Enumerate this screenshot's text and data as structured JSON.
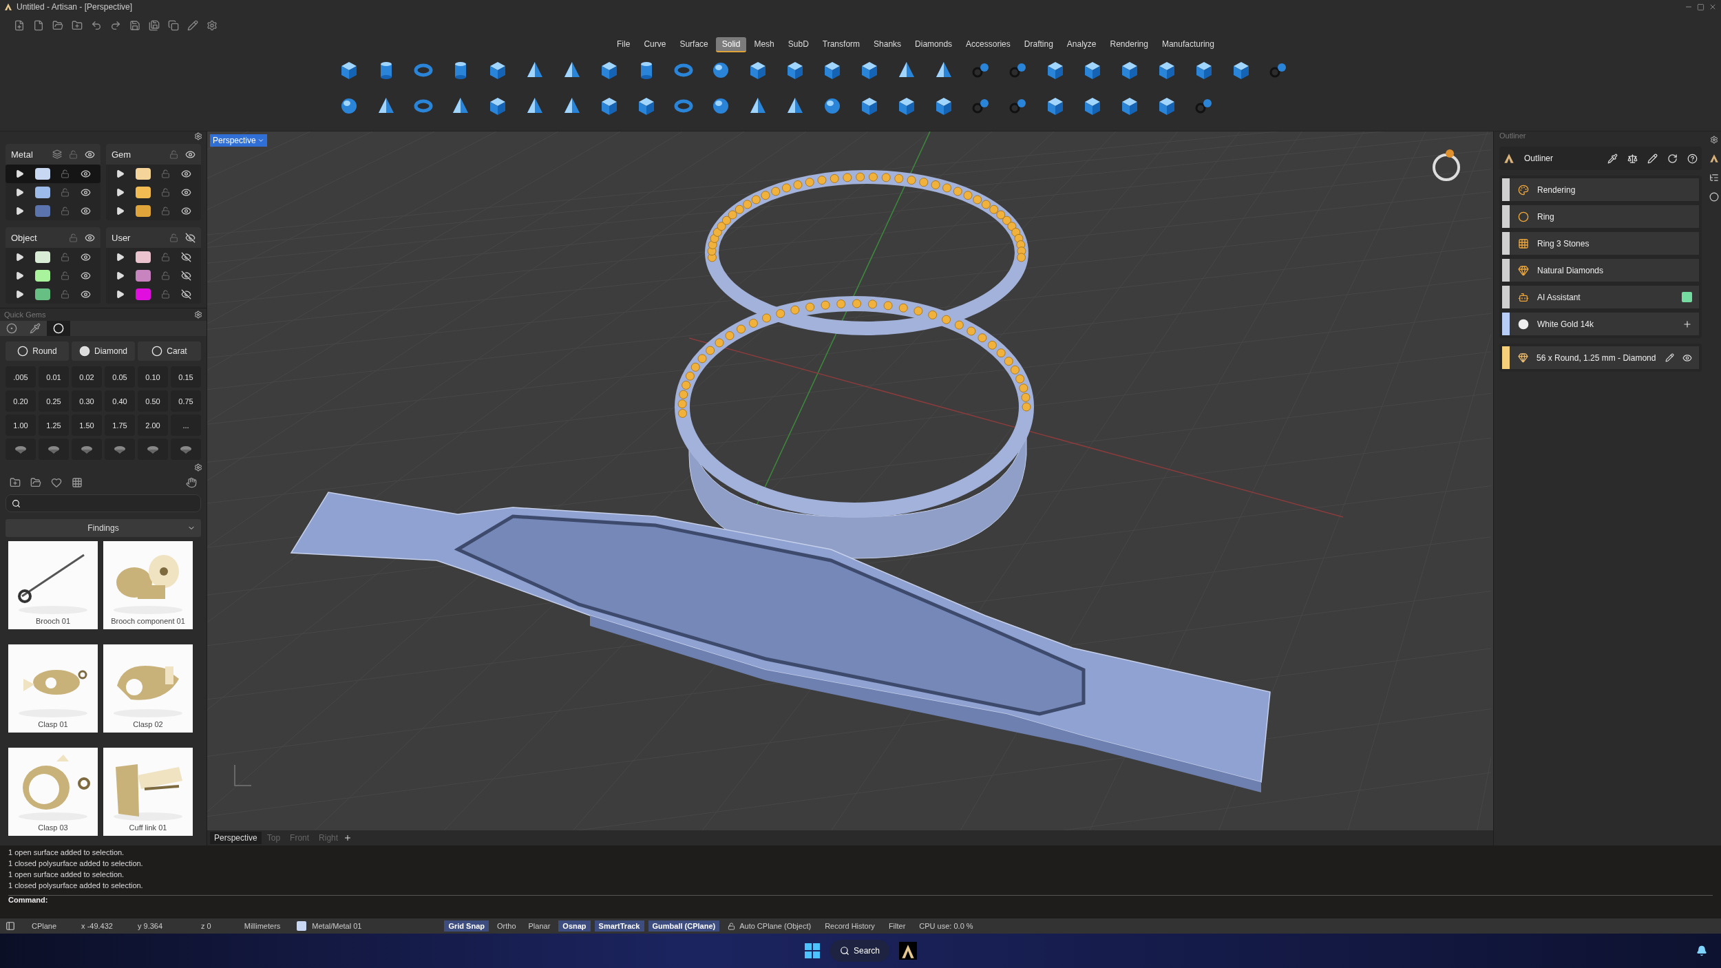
{
  "window": {
    "title": "Untitled - Artisan - [Perspective]"
  },
  "menu": [
    {
      "label": "File",
      "selected": false
    },
    {
      "label": "Curve",
      "selected": false
    },
    {
      "label": "Surface",
      "selected": false
    },
    {
      "label": "Solid",
      "selected": true
    },
    {
      "label": "Mesh",
      "selected": false
    },
    {
      "label": "SubD",
      "selected": false
    },
    {
      "label": "Transform",
      "selected": false
    },
    {
      "label": "Shanks",
      "selected": false
    },
    {
      "label": "Diamonds",
      "selected": false
    },
    {
      "label": "Accessories",
      "selected": false
    },
    {
      "label": "Drafting",
      "selected": false
    },
    {
      "label": "Analyze",
      "selected": false
    },
    {
      "label": "Rendering",
      "selected": false
    },
    {
      "label": "Manufacturing",
      "selected": false
    }
  ],
  "layer_groups": [
    {
      "name": "Metal",
      "kind": "material",
      "visible": true,
      "layers": [
        {
          "color": "#c8d8f2",
          "selected": true,
          "visible": true
        },
        {
          "color": "#9dbbe8",
          "selected": false,
          "visible": true
        },
        {
          "color": "#5b74ae",
          "selected": false,
          "visible": true
        }
      ]
    },
    {
      "name": "Gem",
      "kind": "plain",
      "visible": true,
      "layers": [
        {
          "color": "#f5d49a",
          "selected": false,
          "visible": true
        },
        {
          "color": "#f3bc52",
          "selected": false,
          "visible": true
        },
        {
          "color": "#e0a53a",
          "selected": false,
          "visible": true
        }
      ]
    },
    {
      "name": "Object",
      "kind": "plain",
      "visible": true,
      "layers": [
        {
          "color": "#d9ecd6",
          "selected": false,
          "visible": true
        },
        {
          "color": "#a8f39c",
          "selected": false,
          "visible": true
        },
        {
          "color": "#67bf83",
          "selected": false,
          "visible": true
        }
      ]
    },
    {
      "name": "User",
      "kind": "plain",
      "visible": false,
      "layers": [
        {
          "color": "#eac3cf",
          "selected": false,
          "visible": false
        },
        {
          "color": "#c884bf",
          "selected": false,
          "visible": false
        },
        {
          "color": "#e10ee0",
          "selected": false,
          "visible": false
        }
      ]
    }
  ],
  "quick_gems": {
    "title": "Quick Gems",
    "tabs": [
      {
        "selected": false
      },
      {
        "selected": false
      },
      {
        "selected": true
      }
    ],
    "options": [
      "Round",
      "Diamond",
      "Carat"
    ],
    "sizes": [
      ".005",
      "0.01",
      "0.02",
      "0.05",
      "0.10",
      "0.15",
      "0.20",
      "0.25",
      "0.30",
      "0.40",
      "0.50",
      "0.75",
      "1.00",
      "1.25",
      "1.50",
      "1.75",
      "2.00",
      "..."
    ]
  },
  "library": {
    "category": "Findings",
    "items": [
      {
        "label": "Brooch 01"
      },
      {
        "label": "Brooch component 01"
      },
      {
        "label": "Clasp 01"
      },
      {
        "label": "Clasp 02"
      },
      {
        "label": "Clasp 03"
      },
      {
        "label": "Cuff link 01"
      }
    ]
  },
  "viewport": {
    "label": "Perspective",
    "tabs": [
      {
        "label": "Perspective",
        "selected": true
      },
      {
        "label": "Top",
        "selected": false
      },
      {
        "label": "Front",
        "selected": false
      },
      {
        "label": "Right",
        "selected": false
      }
    ]
  },
  "outliner": {
    "panel_title": "Outliner",
    "title": "Outliner",
    "items": [
      {
        "label": "Rendering",
        "kind": "plain",
        "color": "#cfcfcf"
      },
      {
        "label": "Ring",
        "kind": "plain",
        "color": "#cfcfcf"
      },
      {
        "label": "Ring 3 Stones",
        "kind": "plain",
        "color": "#cfcfcf"
      },
      {
        "label": "Natural Diamonds",
        "kind": "plain",
        "color": "#cfcfcf"
      },
      {
        "label": "AI Assistant",
        "kind": "toggle",
        "on": true,
        "color": "#cfcfcf"
      },
      {
        "label": "White Gold 14k",
        "kind": "add",
        "color": "#b8cdf5"
      }
    ],
    "selection": {
      "label": "56 x Round, 1.25 mm - Diamond",
      "color": "#f5cf7a"
    }
  },
  "command_history": [
    "1 open surface added to selection.",
    "1 closed polysurface added to selection.",
    "1 open surface added to selection.",
    "1 closed polysurface added to selection."
  ],
  "command_prompt": "Command:",
  "status": {
    "cplane": "CPlane",
    "x": "x -49.432",
    "y": "y 9.364",
    "z": "z 0",
    "units": "Millimeters",
    "layer": {
      "label": "Metal/Metal 01",
      "color": "#c8d8f2"
    },
    "toggles": [
      {
        "label": "Grid Snap",
        "on": true
      },
      {
        "label": "Ortho",
        "on": false
      },
      {
        "label": "Planar",
        "on": false
      },
      {
        "label": "Osnap",
        "on": true
      },
      {
        "label": "SmartTrack",
        "on": true
      },
      {
        "label": "Gumball (CPlane)",
        "on": true
      }
    ],
    "auto_cplane": "Auto CPlane (Object)",
    "record_history": "Record History",
    "filter": "Filter",
    "cpu": "CPU use: 0.0 %"
  },
  "taskbar": {
    "search": "Search"
  }
}
